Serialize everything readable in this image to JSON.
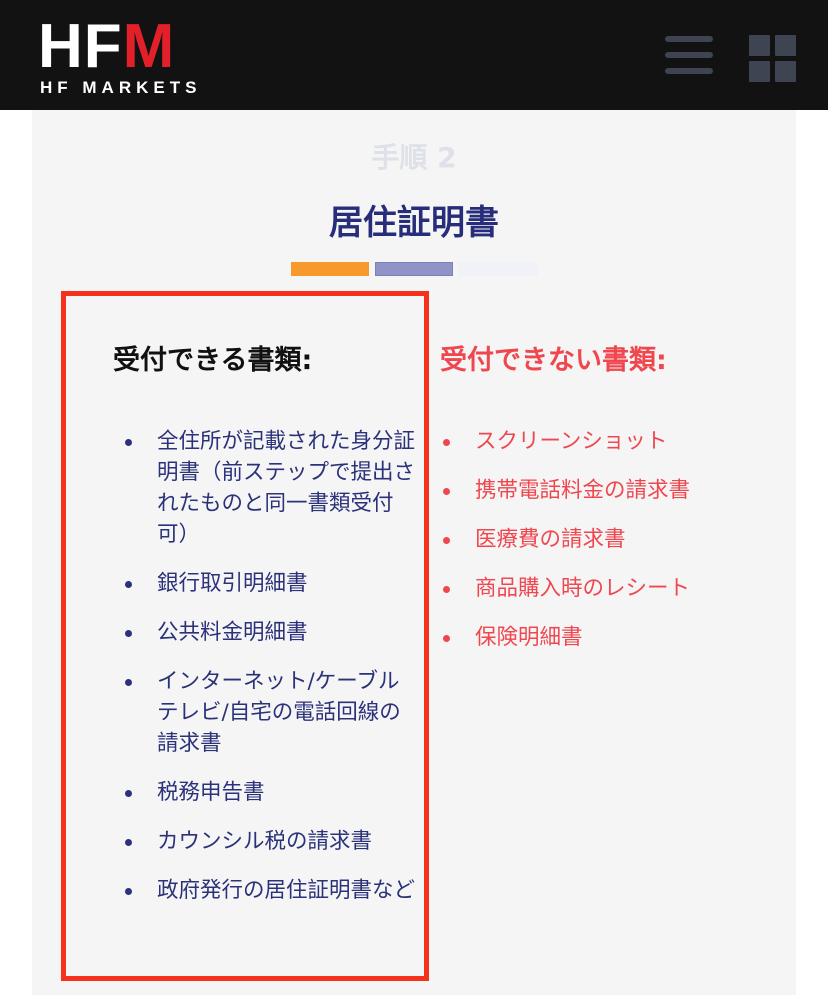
{
  "header": {
    "logo_text": "HFM",
    "logo_main": "HF",
    "logo_accent": "M",
    "logo_sub": "HF MARKETS",
    "menu_icon": "hamburger-menu-icon",
    "apps_icon": "grid-icon"
  },
  "step": {
    "label": "手順 2",
    "title": "居住証明書"
  },
  "progress": {
    "steps": 3,
    "current": 2,
    "colors": [
      "#f79a2b",
      "#8f93c6",
      "#f0f2f7"
    ]
  },
  "accepted": {
    "title": "受付できる書類:",
    "items": [
      "全住所が記載された身分証明書（前ステップで提出されたものと同一書類受付可）",
      "銀行取引明細書",
      "公共料金明細書",
      "インターネット/ケーブルテレビ/自宅の電話回線の請求書",
      "税務申告書",
      "カウンシル税の請求書",
      "政府発行の居住証明書など"
    ]
  },
  "rejected": {
    "title": "受付できない書類:",
    "items": [
      "スクリーンショット",
      "携帯電話料金の請求書",
      "医療費の請求書",
      "商品購入時のレシート",
      "保険明細書"
    ]
  },
  "colors": {
    "header_bg": "#121212",
    "brand_red": "#e2202a",
    "accent_navy": "#272d7a",
    "reject_red": "#f0474f",
    "highlight_border": "#f5321e"
  }
}
